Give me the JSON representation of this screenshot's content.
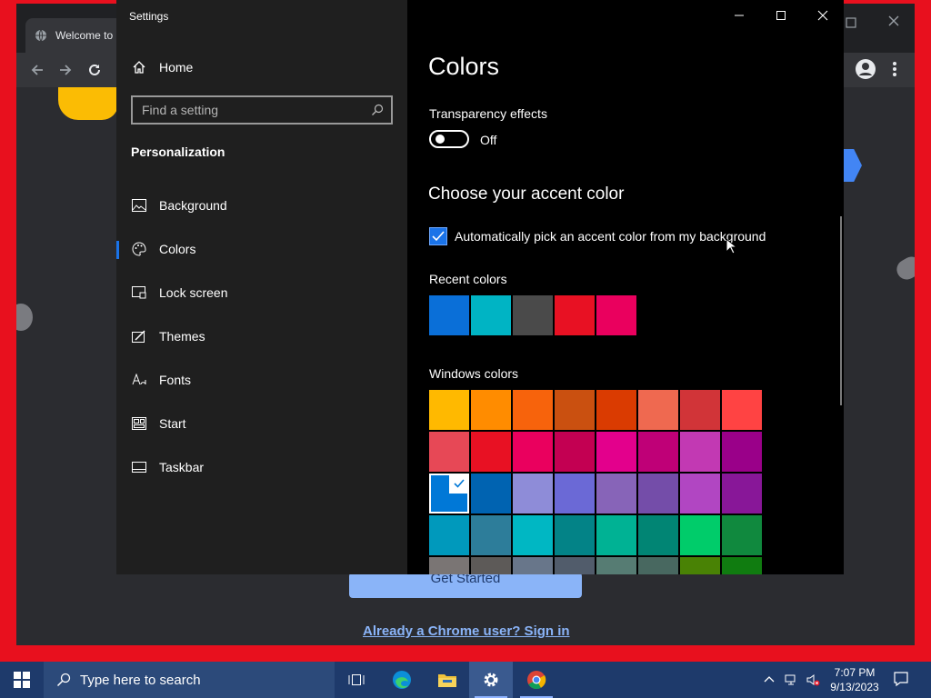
{
  "chrome": {
    "tab_title": "Welcome to",
    "get_started": "Get Started",
    "signin_link": "Already a Chrome user? Sign in"
  },
  "settings": {
    "app_title": "Settings",
    "home_label": "Home",
    "search_placeholder": "Find a setting",
    "section": "Personalization",
    "nav": [
      {
        "label": "Background",
        "icon": "image-icon"
      },
      {
        "label": "Colors",
        "icon": "palette-icon",
        "active": true
      },
      {
        "label": "Lock screen",
        "icon": "lock-screen-icon"
      },
      {
        "label": "Themes",
        "icon": "themes-icon"
      },
      {
        "label": "Fonts",
        "icon": "fonts-icon"
      },
      {
        "label": "Start",
        "icon": "start-icon"
      },
      {
        "label": "Taskbar",
        "icon": "taskbar-icon"
      }
    ],
    "page_title": "Colors",
    "transparency": {
      "label": "Transparency effects",
      "state": "Off"
    },
    "accent_heading": "Choose your accent color",
    "auto_pick": {
      "label": "Automatically pick an accent color from my background",
      "checked": true
    },
    "recent_label": "Recent colors",
    "recent_colors": [
      "#0a6fd8",
      "#00b4c4",
      "#4a4a4a",
      "#e81123",
      "#ea005e"
    ],
    "windows_label": "Windows colors",
    "windows_colors": [
      "#ffb900",
      "#ff8c00",
      "#f7630c",
      "#ca5010",
      "#da3b01",
      "#ef6950",
      "#d13438",
      "#ff4343",
      "#e74856",
      "#e81123",
      "#ea005e",
      "#c30052",
      "#e3008c",
      "#bf0077",
      "#c239b3",
      "#9a0089",
      "#0078d7",
      "#0063b1",
      "#8e8cd8",
      "#6b69d6",
      "#8764b8",
      "#744da9",
      "#b146c2",
      "#881798",
      "#0099bc",
      "#2d7d9a",
      "#00b7c3",
      "#038387",
      "#00b294",
      "#018574",
      "#00cc6a",
      "#10893e",
      "#7a7574",
      "#5d5a58",
      "#68768a",
      "#515c6b",
      "#567c73",
      "#486860",
      "#498205",
      "#107c10"
    ],
    "selected_color_index": 16
  },
  "taskbar": {
    "search_placeholder": "Type here to search",
    "time": "7:07 PM",
    "date": "9/13/2023"
  }
}
